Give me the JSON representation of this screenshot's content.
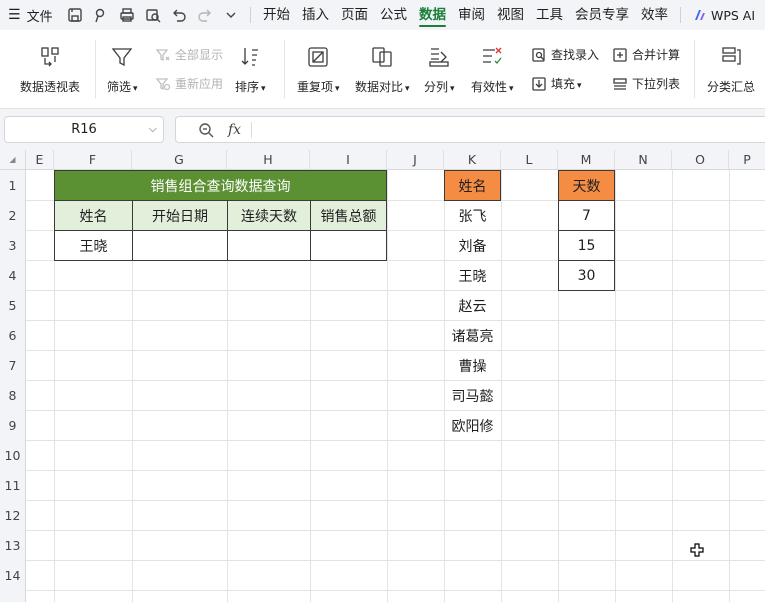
{
  "menubar": {
    "file_label": "文件",
    "menus": [
      "开始",
      "插入",
      "页面",
      "公式",
      "数据",
      "审阅",
      "视图",
      "工具",
      "会员专享",
      "效率"
    ],
    "active_menu": "数据",
    "wps_ai": "WPS AI"
  },
  "ribbon": {
    "pivot": "数据透视表",
    "filter": "筛选",
    "show_all": "全部显示",
    "reapply": "重新应用",
    "sort": "排序",
    "duplicates": "重复项",
    "compare": "数据对比",
    "split": "分列",
    "validity": "有效性",
    "find_entry": "查找录入",
    "fill": "填充",
    "consolidate": "合并计算",
    "dropdown_list": "下拉列表",
    "subtotal": "分类汇总"
  },
  "formula_bar": {
    "name_box": "R16",
    "fx": "fx",
    "formula": ""
  },
  "columns": [
    "E",
    "F",
    "G",
    "H",
    "I",
    "J",
    "K",
    "L",
    "M",
    "N",
    "O",
    "P"
  ],
  "rows": [
    "1",
    "2",
    "3",
    "4",
    "5",
    "6",
    "7",
    "8",
    "9",
    "10",
    "11",
    "12",
    "13",
    "14"
  ],
  "query_table": {
    "title": "销售组合查询数据查询",
    "headers": [
      "姓名",
      "开始日期",
      "连续天数",
      "销售总额"
    ],
    "row": [
      "王晓",
      "",
      "",
      ""
    ]
  },
  "names_list": {
    "header": "姓名",
    "items": [
      "张飞",
      "刘备",
      "王晓",
      "赵云",
      "诸葛亮",
      "曹操",
      "司马懿",
      "欧阳修"
    ]
  },
  "days_list": {
    "header": "天数",
    "items": [
      "7",
      "15",
      "30"
    ]
  },
  "colors": {
    "title_green": "#5b9133",
    "header_green": "#e2efda",
    "orange": "#f48d43",
    "active_tab": "#1a7f37"
  }
}
